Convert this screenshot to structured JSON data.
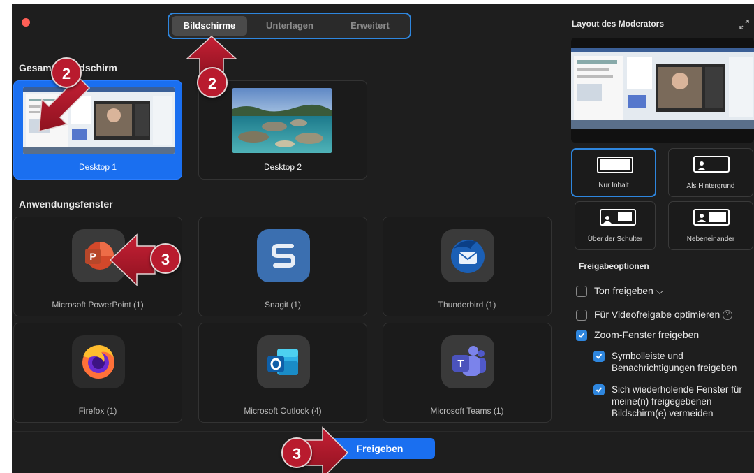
{
  "tabs": [
    {
      "label": "Bildschirme",
      "active": true
    },
    {
      "label": "Unterlagen",
      "active": false
    },
    {
      "label": "Erweitert",
      "active": false
    }
  ],
  "sections": {
    "screens_title": "Gesamter Bildschirm",
    "apps_title": "Anwendungsfenster"
  },
  "screens": [
    {
      "label": "Desktop 1",
      "selected": true
    },
    {
      "label": "Desktop 2",
      "selected": false
    }
  ],
  "apps": [
    {
      "label": "Microsoft PowerPoint (1)",
      "icon": "powerpoint-icon"
    },
    {
      "label": "Snagit (1)",
      "icon": "snagit-icon"
    },
    {
      "label": "Thunderbird (1)",
      "icon": "thunderbird-icon"
    },
    {
      "label": "Firefox (1)",
      "icon": "firefox-icon"
    },
    {
      "label": "Microsoft Outlook (4)",
      "icon": "outlook-icon"
    },
    {
      "label": "Microsoft Teams (1)",
      "icon": "teams-icon"
    }
  ],
  "right_panel": {
    "title": "Layout des Moderators",
    "layouts": [
      {
        "label": "Nur Inhalt",
        "active": true
      },
      {
        "label": "Als Hintergrund",
        "active": false
      },
      {
        "label": "Über der Schulter",
        "active": false
      },
      {
        "label": "Nebeneinander",
        "active": false
      }
    ],
    "options_title": "Freigabeoptionen",
    "options": [
      {
        "label": "Ton freigeben ⌵",
        "checked": false
      },
      {
        "label": "Für Videofreigabe optimieren",
        "checked": false
      },
      {
        "label": "Zoom-Fenster freigeben",
        "checked": true
      },
      {
        "label": "Symbolleiste und Benachrichtigungen freigeben",
        "checked": true
      },
      {
        "label": "Sich wiederholende Fenster für meine(n) freigegebenen Bildschirm(e) vermeiden",
        "checked": true
      }
    ],
    "help_glyph": "?"
  },
  "footer": {
    "share_label": "Freigeben"
  },
  "annotations": [
    "2",
    "2",
    "3",
    "3"
  ],
  "colors": {
    "accent": "#1a6ff0",
    "annotation": "#b91b2e",
    "background": "#1e1e1e"
  }
}
